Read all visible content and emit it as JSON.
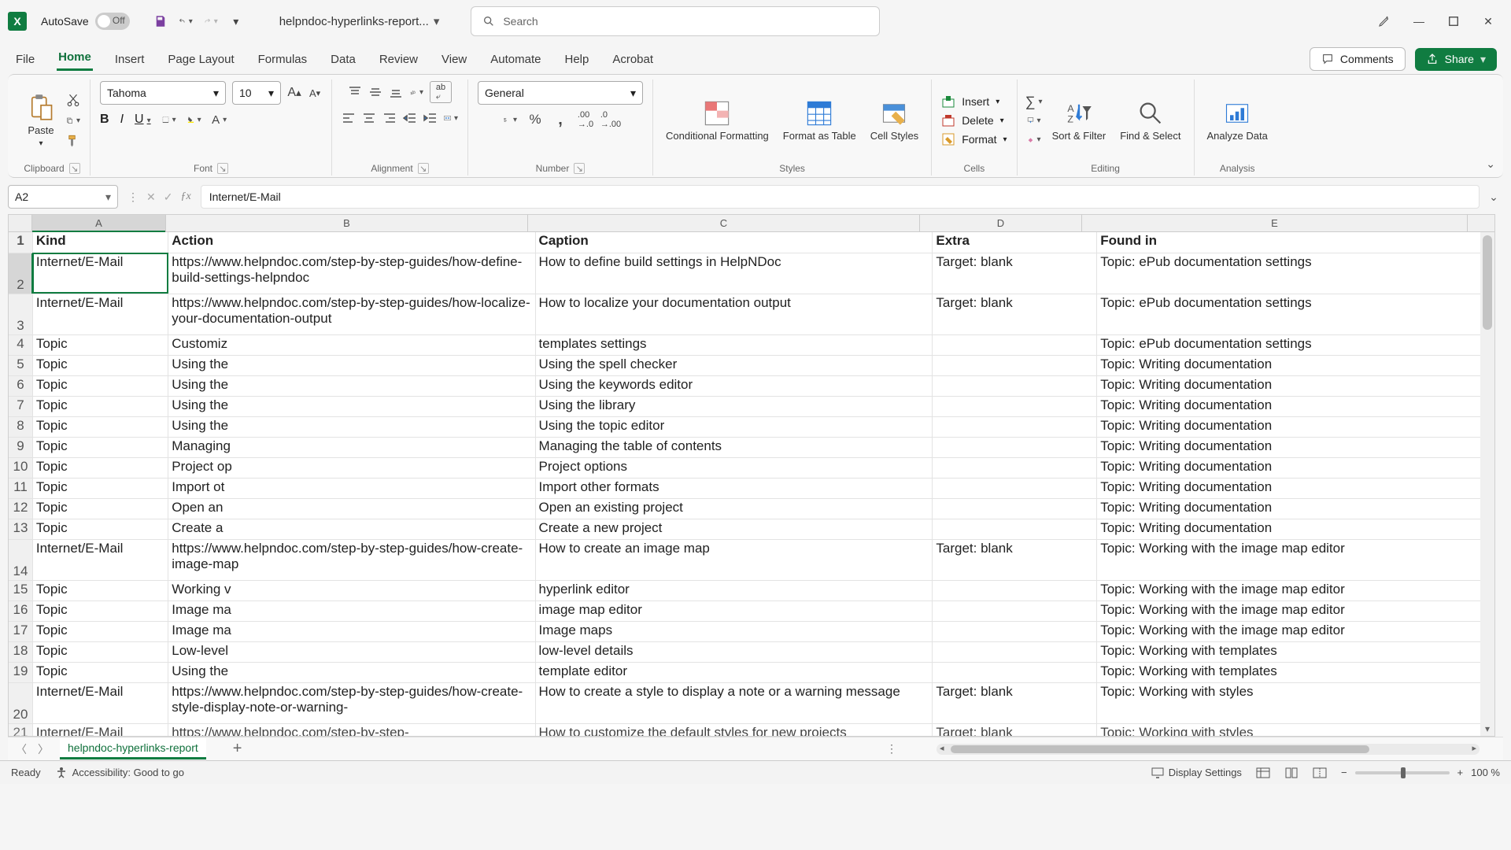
{
  "title": {
    "autosave": "AutoSave",
    "autosave_state": "Off",
    "doc": "helpndoc-hyperlinks-report...",
    "search_placeholder": "Search"
  },
  "window_buttons": {
    "min": "—",
    "max": "▢",
    "close": "✕"
  },
  "tabs": [
    "File",
    "Home",
    "Insert",
    "Page Layout",
    "Formulas",
    "Data",
    "Review",
    "View",
    "Automate",
    "Help",
    "Acrobat"
  ],
  "active_tab": "Home",
  "comments": "Comments",
  "share": "Share",
  "ribbon": {
    "clipboard": {
      "paste": "Paste",
      "label": "Clipboard"
    },
    "font": {
      "name": "Tahoma",
      "size": "10",
      "label": "Font"
    },
    "alignment": {
      "label": "Alignment"
    },
    "number": {
      "format": "General",
      "label": "Number"
    },
    "styles": {
      "cond": "Conditional Formatting",
      "table": "Format as Table",
      "cell": "Cell Styles",
      "label": "Styles"
    },
    "cells": {
      "insert": "Insert",
      "delete": "Delete",
      "format": "Format",
      "label": "Cells"
    },
    "editing": {
      "sort": "Sort & Filter",
      "find": "Find & Select",
      "label": "Editing"
    },
    "analysis": {
      "analyze": "Analyze Data",
      "label": "Analysis"
    }
  },
  "namebox": "A2",
  "formula": "Internet/E-Mail",
  "columns": [
    "A",
    "B",
    "C",
    "D",
    "E"
  ],
  "headers": {
    "A": "Kind",
    "B": "Action",
    "C": "Caption",
    "D": "Extra",
    "E": "Found in"
  },
  "rows": [
    {
      "n": 2,
      "tall": true,
      "A": "Internet/E-Mail",
      "B": "https://www.helpndoc.com/step-by-step-guides/how-define-build-settings-helpndoc",
      "Bshort": "https://www.helpndoc.com/step-by-step-guides/how-define-build-settings-helpndoc",
      "C": "How to define build settings in HelpNDoc",
      "D": "Target: blank",
      "E": "Topic: ePub documentation settings"
    },
    {
      "n": 3,
      "tall": true,
      "A": "Internet/E-Mail",
      "B": "https://www.helpndoc.com/step-by-step-guides/how-localize-your-documentation-output",
      "C": "How to localize your documentation output",
      "D": "Target: blank",
      "E": "Topic: ePub documentation settings"
    },
    {
      "n": 4,
      "A": "Topic",
      "B": "Customiz",
      "C": "templates settings",
      "D": "",
      "E": "Topic: ePub documentation settings"
    },
    {
      "n": 5,
      "A": "Topic",
      "B": "Using the",
      "C": "Using the spell checker",
      "D": "",
      "E": "Topic: Writing documentation"
    },
    {
      "n": 6,
      "A": "Topic",
      "B": "Using the",
      "C": "Using the keywords editor",
      "D": "",
      "E": "Topic: Writing documentation"
    },
    {
      "n": 7,
      "A": "Topic",
      "B": "Using the",
      "C": "Using the library",
      "D": "",
      "E": "Topic: Writing documentation"
    },
    {
      "n": 8,
      "A": "Topic",
      "B": "Using the",
      "C": "Using the topic editor",
      "D": "",
      "E": "Topic: Writing documentation"
    },
    {
      "n": 9,
      "A": "Topic",
      "B": "Managing",
      "C": "Managing the table of contents",
      "D": "",
      "E": "Topic: Writing documentation"
    },
    {
      "n": 10,
      "A": "Topic",
      "B": "Project op",
      "C": "Project options",
      "D": "",
      "E": "Topic: Writing documentation"
    },
    {
      "n": 11,
      "A": "Topic",
      "B": "Import ot",
      "C": "Import other formats",
      "D": "",
      "E": "Topic: Writing documentation"
    },
    {
      "n": 12,
      "A": "Topic",
      "B": "Open an ",
      "C": "Open an existing project",
      "D": "",
      "E": "Topic: Writing documentation"
    },
    {
      "n": 13,
      "A": "Topic",
      "B": "Create a ",
      "C": "Create a new project",
      "D": "",
      "E": "Topic: Writing documentation"
    },
    {
      "n": 14,
      "tall": true,
      "A": "Internet/E-Mail",
      "B": "https://www.helpndoc.com/step-by-step-guides/how-create-image-map",
      "C": "How to create an image map",
      "D": "Target: blank",
      "E": "Topic: Working with the image map editor"
    },
    {
      "n": 15,
      "A": "Topic",
      "B": "Working v",
      "C": "hyperlink editor",
      "D": "",
      "E": "Topic: Working with the image map editor"
    },
    {
      "n": 16,
      "A": "Topic",
      "B": "Image ma",
      "C": "image map editor",
      "D": "",
      "E": "Topic: Working with the image map editor"
    },
    {
      "n": 17,
      "A": "Topic",
      "B": "Image ma",
      "C": "Image maps",
      "D": "",
      "E": "Topic: Working with the image map editor"
    },
    {
      "n": 18,
      "A": "Topic",
      "B": "Low-level",
      "C": "low-level details",
      "D": "",
      "E": "Topic: Working with templates"
    },
    {
      "n": 19,
      "A": "Topic",
      "B": "Using the",
      "C": "template editor",
      "D": "",
      "E": "Topic: Working with templates"
    },
    {
      "n": 20,
      "tall": true,
      "A": "Internet/E-Mail",
      "B": "https://www.helpndoc.com/step-by-step-guides/how-create-style-display-note-or-warning-",
      "C": "How to create a style to display a note or a warning message",
      "D": "Target: blank",
      "E": "Topic: Working with styles"
    },
    {
      "n": 21,
      "cut": true,
      "A": "Internet/E-Mail",
      "B": "https://www.helpndoc.com/step-by-step-",
      "C": "How to customize the default styles for new projects",
      "D": "Target: blank",
      "E": "Topic: Working with styles"
    }
  ],
  "sheet": "helpndoc-hyperlinks-report",
  "status": {
    "ready": "Ready",
    "acc": "Accessibility: Good to go",
    "display": "Display Settings",
    "zoom": "100 %"
  }
}
